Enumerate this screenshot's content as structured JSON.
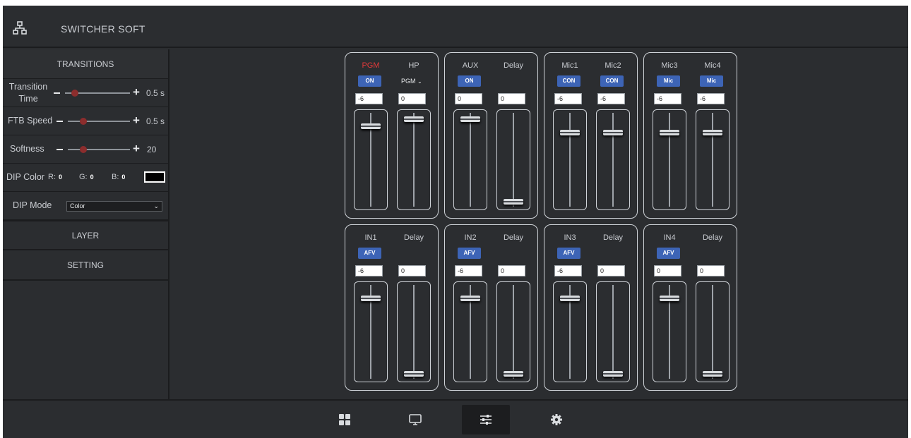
{
  "app": {
    "title": "SWITCHER SOFT",
    "logo_icon": "network-icon"
  },
  "sidebar": {
    "transitions_header": "TRANSITIONS",
    "transition_time": {
      "label_line1": "Transition",
      "label_line2": "Time",
      "value": "0.5 s",
      "level": 0.15
    },
    "ftb_speed": {
      "label": "FTB Speed",
      "value": "0.5 s",
      "level": 0.25
    },
    "softness": {
      "label": "Softness",
      "value": "20",
      "level": 0.25
    },
    "dip_color": {
      "label": "DIP Color",
      "r_label": "R:",
      "r": "0",
      "g_label": "G:",
      "g": "0",
      "b_label": "B:",
      "b": "0",
      "swatch_color": "#000000"
    },
    "dip_mode": {
      "label": "DIP Mode",
      "value": "Color"
    },
    "layer_label": "LAYER",
    "setting_label": "SETTING"
  },
  "mixer": {
    "top": [
      {
        "channels": [
          {
            "name": "PGM",
            "red": true,
            "control": "button",
            "button": "ON",
            "value": "-6",
            "level": 0.88
          },
          {
            "name": "HP",
            "control": "dropdown",
            "dropdown": "PGM",
            "value": "0",
            "level": 0.96
          }
        ]
      },
      {
        "channels": [
          {
            "name": "AUX",
            "control": "button",
            "button": "ON",
            "value": "0",
            "level": 0.96
          },
          {
            "name": "Delay",
            "control": "none",
            "value": "0",
            "level": 0.0
          }
        ]
      },
      {
        "channels": [
          {
            "name": "Mic1",
            "control": "button",
            "button": "CON",
            "value": "-6",
            "level": 0.8
          },
          {
            "name": "Mic2",
            "control": "button",
            "button": "CON",
            "value": "-6",
            "level": 0.8
          }
        ]
      },
      {
        "channels": [
          {
            "name": "Mic3",
            "control": "button",
            "button": "Mic",
            "value": "-6",
            "level": 0.8
          },
          {
            "name": "Mic4",
            "control": "button",
            "button": "Mic",
            "value": "-6",
            "level": 0.8
          }
        ]
      }
    ],
    "bottom": [
      {
        "channels": [
          {
            "name": "IN1",
            "control": "button",
            "button": "AFV",
            "value": "-6",
            "level": 0.88
          },
          {
            "name": "Delay",
            "control": "none",
            "value": "0",
            "level": 0.0
          }
        ]
      },
      {
        "channels": [
          {
            "name": "IN2",
            "control": "button",
            "button": "AFV",
            "value": "-6",
            "level": 0.88
          },
          {
            "name": "Delay",
            "control": "none",
            "value": "0",
            "level": 0.0
          }
        ]
      },
      {
        "channels": [
          {
            "name": "IN3",
            "control": "button",
            "button": "AFV",
            "value": "-6",
            "level": 0.88
          },
          {
            "name": "Delay",
            "control": "none",
            "value": "0",
            "level": 0.0
          }
        ]
      },
      {
        "channels": [
          {
            "name": "IN4",
            "control": "button",
            "button": "AFV",
            "value": "0",
            "level": 0.88
          },
          {
            "name": "Delay",
            "control": "none",
            "value": "0",
            "level": 0.0
          }
        ]
      }
    ]
  },
  "footer": {
    "tabs": [
      {
        "icon": "grid-icon",
        "active": false
      },
      {
        "icon": "monitor-icon",
        "active": false
      },
      {
        "icon": "sliders-icon",
        "active": true
      },
      {
        "icon": "gear-icon",
        "active": false
      }
    ]
  },
  "colors": {
    "background": "#2b2d30",
    "accent": "#3d64b6",
    "pgm_red": "#e03a3a",
    "slider_knob": "#8c2d2d"
  }
}
